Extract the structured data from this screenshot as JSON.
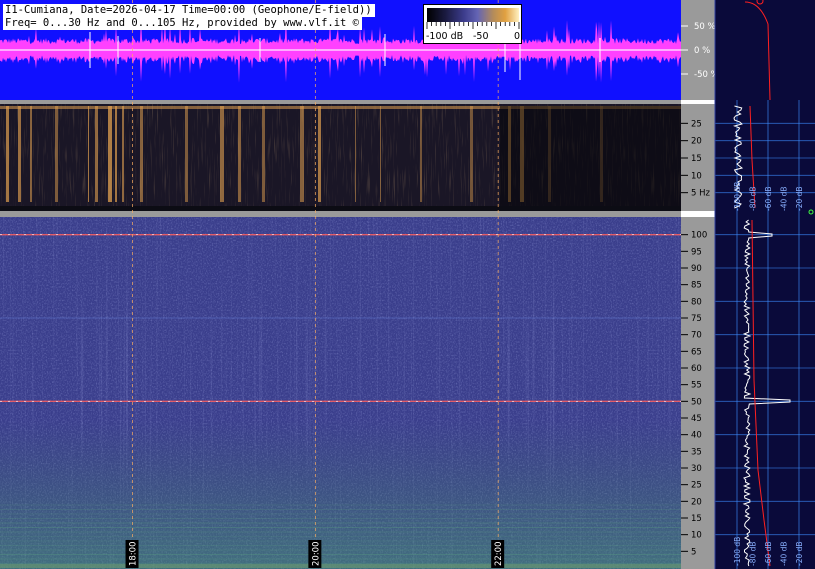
{
  "header": {
    "line1": "I1-Cumiana, Date=2026-04-17 Time=00:00 (Geophone/E-field))",
    "line2": "Freq= 0...30 Hz and 0...105 Hz, provided by www.vlf.it ©"
  },
  "colorbar": {
    "labels": [
      "-100 dB",
      "-50",
      "0"
    ]
  },
  "colors": {
    "waveform_bg": "#1010ff",
    "waveform": "#ff40ff",
    "spectro_low_bg": "#1a1626",
    "spectro_high_bg": "#3a3e8c",
    "side_bg": "#0a0a3a",
    "axis_bg": "#9a9a9a",
    "trace": "#ffffff",
    "fit": "#ff2020",
    "grid": "#3c8cff"
  },
  "chart_data": [
    {
      "type": "line",
      "name": "waveform",
      "ylabels": [
        "50 %",
        "0 %",
        "-50 %"
      ],
      "yticks": [
        50,
        0,
        -50
      ],
      "ylim": [
        -100,
        100
      ]
    },
    {
      "type": "heatmap",
      "name": "low-frequency spectrogram",
      "ylim": [
        0,
        30
      ],
      "yticks": [
        5,
        10,
        15,
        20,
        25
      ],
      "ylabels": [
        "5 Hz",
        "10",
        "15",
        "20",
        "25"
      ],
      "side_labels": [
        "-100 dB",
        "-80 dB",
        "-60 dB",
        "-40 dB",
        "-20 dB"
      ]
    },
    {
      "type": "heatmap",
      "name": "high-frequency spectrogram",
      "ylim": [
        0,
        105
      ],
      "yticks": [
        5,
        10,
        15,
        20,
        25,
        30,
        35,
        40,
        45,
        50,
        55,
        60,
        65,
        70,
        75,
        80,
        85,
        90,
        95,
        100
      ],
      "ylabels": [
        "5",
        "10",
        "15",
        "20",
        "25",
        "30",
        "35",
        "40",
        "45",
        "50",
        "55",
        "60",
        "65",
        "70",
        "75",
        "80",
        "85",
        "90",
        "95",
        "100"
      ],
      "lines_hz": [
        50,
        100
      ],
      "side_labels": [
        "-100 dB",
        "-80 dB",
        "-60 dB",
        "-40 dB",
        "-20 dB"
      ]
    }
  ],
  "time_axis": {
    "labels": [
      "18:00",
      "20:00",
      "22:00"
    ],
    "hours": [
      18,
      20,
      22
    ],
    "range": [
      16.55,
      24.0
    ]
  }
}
